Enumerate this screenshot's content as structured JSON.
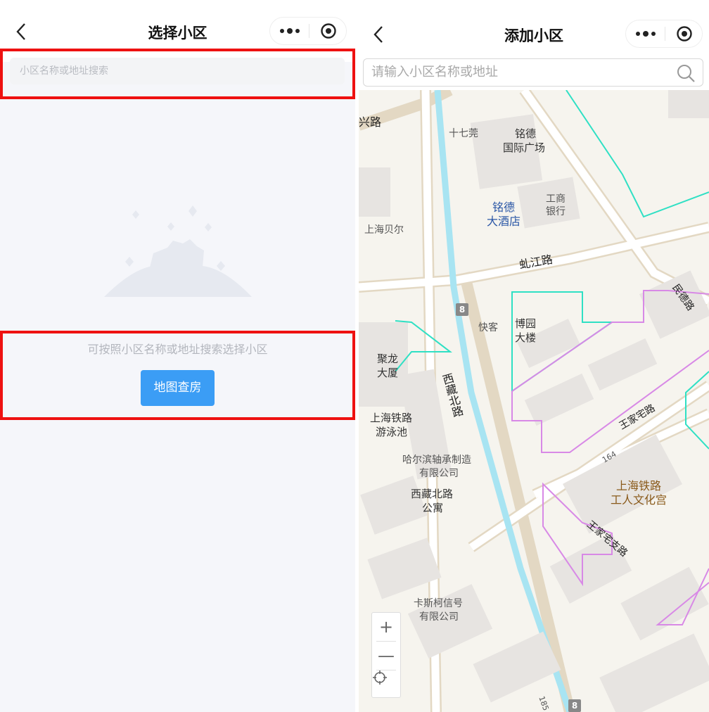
{
  "left": {
    "title": "选择小区",
    "search_placeholder": "小区名称或地址搜索",
    "empty_hint": "可按照小区名称或地址搜索选择小区",
    "map_button": "地图查房"
  },
  "right": {
    "title": "添加小区",
    "search_placeholder": "请输入小区名称或地址",
    "map": {
      "labels": {
        "xinglu": "兴路",
        "shiqi": "十七莞",
        "mingde_plaza_1": "铭德",
        "mingde_plaza_2": "国际广场",
        "icbc_1": "工商",
        "icbc_2": "银行",
        "mingde_hotel_1": "铭德",
        "mingde_hotel_2": "大酒店",
        "shanghai_beier": "上海贝尔",
        "qiujiang_rd": "虬江路",
        "minde_rd": "民德路",
        "kuaike": "快客",
        "boyuan_1": "博园",
        "boyuan_2": "大楼",
        "julong_1": "聚龙",
        "julong_2": "大厦",
        "xizang_n_rd_road": "西藏北路",
        "pool_1": "上海铁路",
        "pool_2": "游泳池",
        "harbin_1": "哈尔滨轴承制造",
        "harbin_2": "有限公司",
        "apartment_1": "西藏北路",
        "apartment_2": "公寓",
        "wangjiazhai_rd": "王家宅路",
        "wangjiazhai_branch": "王家宅支路",
        "workers_1": "上海铁路",
        "workers_2": "工人文化宫",
        "casio_1": "卡斯柯信号",
        "casio_2": "有限公司",
        "num_164": "164",
        "num_185": "185",
        "route_8a": "8",
        "route_8b": "8"
      },
      "zoom_in": "+",
      "zoom_out": "—"
    }
  },
  "icons": {
    "back": "chevron-left-icon",
    "more": "more-dots-icon",
    "target": "target-icon",
    "search": "search-icon",
    "locate": "locate-icon"
  },
  "colors": {
    "primary_button": "#3b9df5",
    "highlight": "#ee1111",
    "boundary_cyan": "#2fe0c4",
    "boundary_purple": "#d889e6",
    "canal": "#a8e4f2"
  }
}
